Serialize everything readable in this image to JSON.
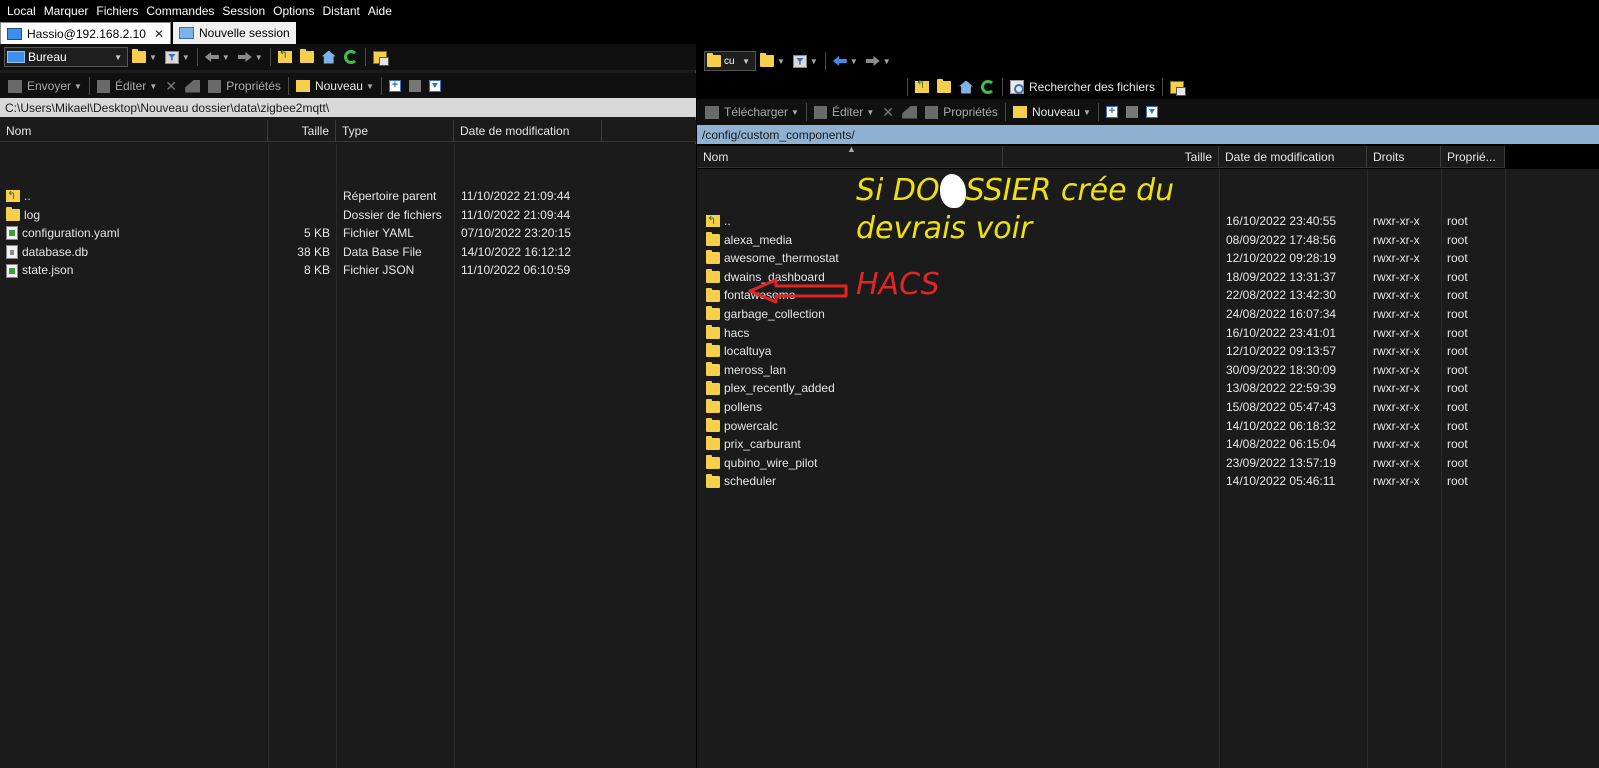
{
  "menu": [
    "Local",
    "Marquer",
    "Fichiers",
    "Commandes",
    "Session",
    "Options",
    "Distant",
    "Aide"
  ],
  "tabs": {
    "session": "Hassio@192.168.2.10",
    "new_session": "Nouvelle session"
  },
  "left": {
    "drive": "Bureau",
    "actions": {
      "send": "Envoyer",
      "edit": "Éditer",
      "properties": "Propriétés",
      "new": "Nouveau"
    },
    "path": "C:\\Users\\Mikael\\Desktop\\Nouveau dossier\\data\\zigbee2mqtt\\",
    "columns": {
      "name": "Nom",
      "size": "Taille",
      "type": "Type",
      "modified": "Date de modification"
    },
    "files": [
      {
        "name": "..",
        "size": "",
        "type": "Répertoire parent",
        "modified": "11/10/2022  21:09:44",
        "icon": "parent-folder-icon"
      },
      {
        "name": "log",
        "size": "",
        "type": "Dossier de fichiers",
        "modified": "11/10/2022  21:09:44",
        "icon": "folder-icon"
      },
      {
        "name": "configuration.yaml",
        "size": "5 KB",
        "type": "Fichier YAML",
        "modified": "07/10/2022  23:20:15",
        "icon": "yaml-file-icon"
      },
      {
        "name": "database.db",
        "size": "38 KB",
        "type": "Data Base File",
        "modified": "14/10/2022  16:12:12",
        "icon": "db-file-icon"
      },
      {
        "name": "state.json",
        "size": "8 KB",
        "type": "Fichier JSON",
        "modified": "11/10/2022  06:10:59",
        "icon": "json-file-icon"
      }
    ]
  },
  "right": {
    "drive": "cu",
    "find_files": "Rechercher des fichiers",
    "actions": {
      "download": "Télécharger",
      "edit": "Éditer",
      "properties": "Propriétés",
      "new": "Nouveau"
    },
    "path": "/config/custom_components/",
    "columns": {
      "name": "Nom",
      "size": "Taille",
      "modified": "Date de modification",
      "rights": "Droits",
      "owner": "Proprié..."
    },
    "files": [
      {
        "name": "..",
        "modified": "16/10/2022 23:40:55",
        "rights": "rwxr-xr-x",
        "owner": "root",
        "icon": "parent-folder-icon"
      },
      {
        "name": "alexa_media",
        "modified": "08/09/2022 17:48:56",
        "rights": "rwxr-xr-x",
        "owner": "root",
        "icon": "folder-icon"
      },
      {
        "name": "awesome_thermostat",
        "modified": "12/10/2022 09:28:19",
        "rights": "rwxr-xr-x",
        "owner": "root",
        "icon": "folder-icon"
      },
      {
        "name": "dwains_dashboard",
        "modified": "18/09/2022 13:31:37",
        "rights": "rwxr-xr-x",
        "owner": "root",
        "icon": "folder-icon"
      },
      {
        "name": "fontawesome",
        "modified": "22/08/2022 13:42:30",
        "rights": "rwxr-xr-x",
        "owner": "root",
        "icon": "folder-icon"
      },
      {
        "name": "garbage_collection",
        "modified": "24/08/2022 16:07:34",
        "rights": "rwxr-xr-x",
        "owner": "root",
        "icon": "folder-icon"
      },
      {
        "name": "hacs",
        "modified": "16/10/2022 23:41:01",
        "rights": "rwxr-xr-x",
        "owner": "root",
        "icon": "folder-icon"
      },
      {
        "name": "localtuya",
        "modified": "12/10/2022 09:13:57",
        "rights": "rwxr-xr-x",
        "owner": "root",
        "icon": "folder-icon"
      },
      {
        "name": "meross_lan",
        "modified": "30/09/2022 18:30:09",
        "rights": "rwxr-xr-x",
        "owner": "root",
        "icon": "folder-icon"
      },
      {
        "name": "plex_recently_added",
        "modified": "13/08/2022 22:59:39",
        "rights": "rwxr-xr-x",
        "owner": "root",
        "icon": "folder-icon"
      },
      {
        "name": "pollens",
        "modified": "15/08/2022 05:47:43",
        "rights": "rwxr-xr-x",
        "owner": "root",
        "icon": "folder-icon"
      },
      {
        "name": "powercalc",
        "modified": "14/10/2022 06:18:32",
        "rights": "rwxr-xr-x",
        "owner": "root",
        "icon": "folder-icon"
      },
      {
        "name": "prix_carburant",
        "modified": "14/08/2022 06:15:04",
        "rights": "rwxr-xr-x",
        "owner": "root",
        "icon": "folder-icon"
      },
      {
        "name": "qubino_wire_pilot",
        "modified": "23/09/2022 13:57:19",
        "rights": "rwxr-xr-x",
        "owner": "root",
        "icon": "folder-icon"
      },
      {
        "name": "scheduler",
        "modified": "14/10/2022 05:46:11",
        "rights": "rwxr-xr-x",
        "owner": "root",
        "icon": "folder-icon"
      }
    ]
  },
  "annotation": {
    "line1": "Si DO",
    "line1b": "SSIER crée du",
    "line2": "devrais voir",
    "line3": "HACS",
    "color_text": "#f0e010",
    "color_arrow": "#e02525"
  }
}
